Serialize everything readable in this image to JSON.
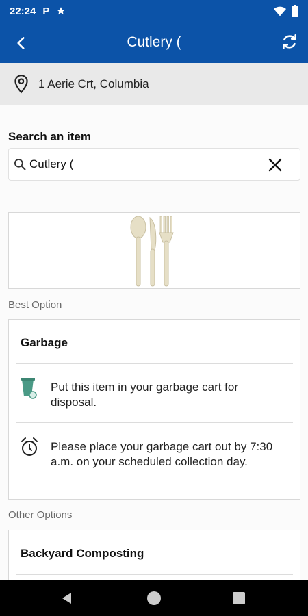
{
  "status_bar": {
    "time": "22:24",
    "icons": [
      "parking-p-icon",
      "star-icon",
      "wifi-icon",
      "battery-icon"
    ]
  },
  "app_bar": {
    "title": "Cutlery (",
    "back_icon": "chevron-left-icon",
    "refresh_icon": "refresh-icon"
  },
  "address": {
    "icon": "location-pin-icon",
    "text": "1 Aerie Crt, Columbia"
  },
  "search": {
    "label": "Search an item",
    "value": "Cutlery (",
    "search_icon": "search-icon",
    "clear_icon": "close-icon"
  },
  "item_image": {
    "description_icon": "cutlery-image"
  },
  "best_option": {
    "section_label": "Best Option",
    "title": "Garbage",
    "rows": [
      {
        "icon": "garbage-cart-icon",
        "text": "Put this item in your garbage cart for disposal."
      },
      {
        "icon": "alarm-clock-icon",
        "text": "Please place your garbage cart out by 7:30 a.m. on your scheduled collection day."
      }
    ]
  },
  "other_options": {
    "section_label": "Other Options",
    "items": [
      {
        "title": "Backyard Composting"
      }
    ]
  },
  "colors": {
    "primary": "#0c53a8",
    "address_bg": "#e9e9e9",
    "cart_green": "#4a9a86"
  }
}
